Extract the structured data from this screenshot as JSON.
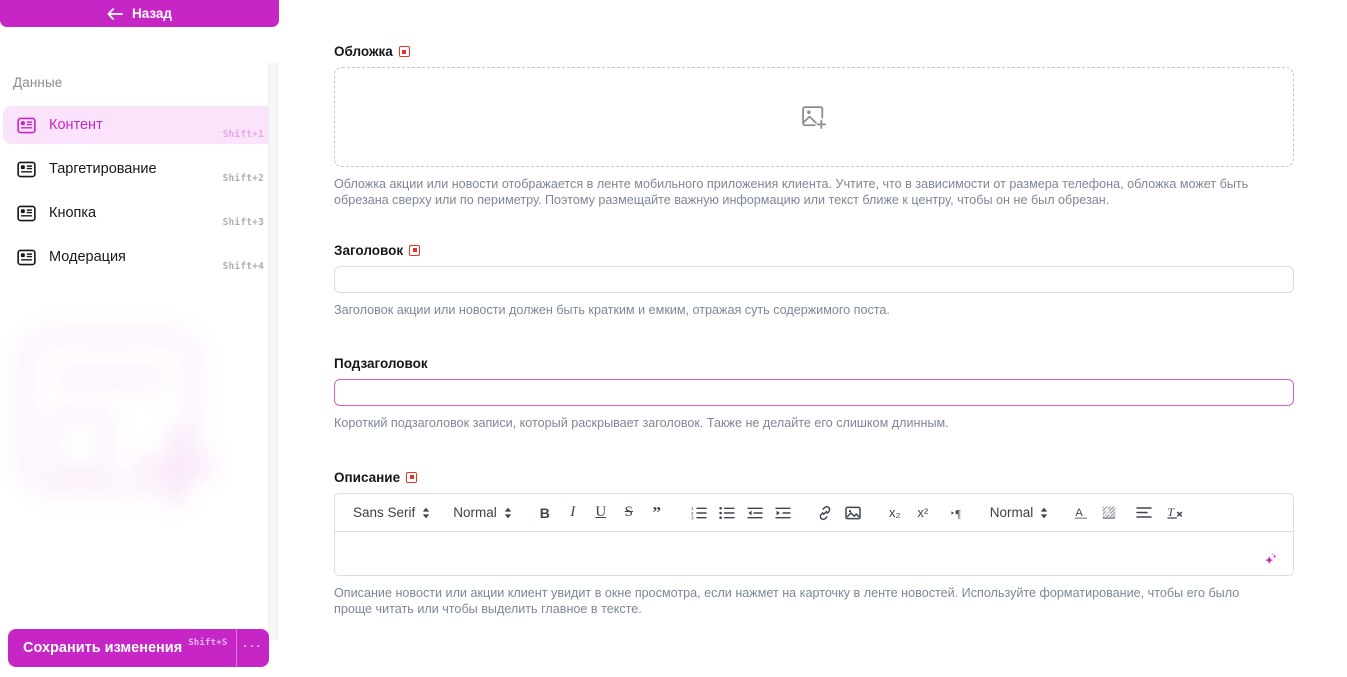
{
  "theme": {
    "accent": "#c626c6",
    "accent_soft": "#fbe3fb",
    "focus_border": "#d15fd1",
    "required_red": "#e5332a",
    "helper_text": "#7d8799"
  },
  "sidebar": {
    "back_label": "Назад",
    "back_icon": "arrow-left-icon",
    "section_label": "Данные",
    "items": [
      {
        "label": "Контент",
        "shortcut": "Shift+1",
        "icon": "content-block-icon",
        "active": true
      },
      {
        "label": "Таргетирование",
        "shortcut": "Shift+2",
        "icon": "content-block-icon",
        "active": false
      },
      {
        "label": "Кнопка",
        "shortcut": "Shift+3",
        "icon": "content-block-icon",
        "active": false
      },
      {
        "label": "Модерация",
        "shortcut": "Shift+4",
        "icon": "content-block-icon",
        "active": false
      }
    ],
    "watermark_icon": "blurred-image-placeholder-graphic",
    "save": {
      "label": "Сохранить изменения",
      "shortcut": "Shift+S",
      "more_label": "···",
      "more_icon": "ellipsis-icon"
    }
  },
  "main": {
    "cover": {
      "label": "Обложка",
      "required": true,
      "upload_icon": "add-image-icon",
      "helper": "Обложка акции или новости отображается в ленте мобильного приложения клиента. Учтите, что в зависимости от размера телефона, обложка может быть обрезана сверху или по периметру. Поэтому размещайте важную информацию или текст ближе к центру, чтобы он не был обрезан."
    },
    "title": {
      "label": "Заголовок",
      "required": true,
      "value": "",
      "placeholder": "",
      "helper": "Заголовок акции или новости должен быть кратким и емким, отражая суть содержимого поста."
    },
    "subtitle": {
      "label": "Подзаголовок",
      "required": false,
      "value": "",
      "placeholder": "",
      "focused": true,
      "helper": "Короткий подзаголовок записи, который раскрывает заголовок. Также не делайте его слишком длинным."
    },
    "description": {
      "label": "Описание",
      "required": true,
      "helper": "Описание новости или акции клиент увидит в окне просмотра, если нажмет на карточку в ленте новостей. Используйте форматирование, чтобы его было проще читать или чтобы выделить главное в тексте.",
      "body_value": "",
      "ai_icon": "sparkle-ai-icon",
      "toolbar": {
        "font_family": "Sans Serif",
        "font_size": "Normal",
        "heading": "Normal",
        "buttons": [
          {
            "name": "bold-icon",
            "glyph": "B"
          },
          {
            "name": "italic-icon",
            "glyph": "I"
          },
          {
            "name": "underline-icon",
            "glyph": "U"
          },
          {
            "name": "strikethrough-icon",
            "glyph": "S"
          },
          {
            "name": "blockquote-icon",
            "glyph": "”"
          },
          {
            "name": "ordered-list-icon",
            "glyph": ""
          },
          {
            "name": "bullet-list-icon",
            "glyph": ""
          },
          {
            "name": "outdent-icon",
            "glyph": ""
          },
          {
            "name": "indent-icon",
            "glyph": ""
          },
          {
            "name": "link-icon",
            "glyph": ""
          },
          {
            "name": "image-icon",
            "glyph": ""
          },
          {
            "name": "subscript-icon",
            "glyph": "x₂"
          },
          {
            "name": "superscript-icon",
            "glyph": "x²"
          },
          {
            "name": "text-direction-icon",
            "glyph": "¶"
          },
          {
            "name": "font-color-icon",
            "glyph": "A"
          },
          {
            "name": "background-color-icon",
            "glyph": "A"
          },
          {
            "name": "align-icon",
            "glyph": ""
          },
          {
            "name": "clear-format-icon",
            "glyph": "Tx"
          }
        ]
      }
    }
  }
}
